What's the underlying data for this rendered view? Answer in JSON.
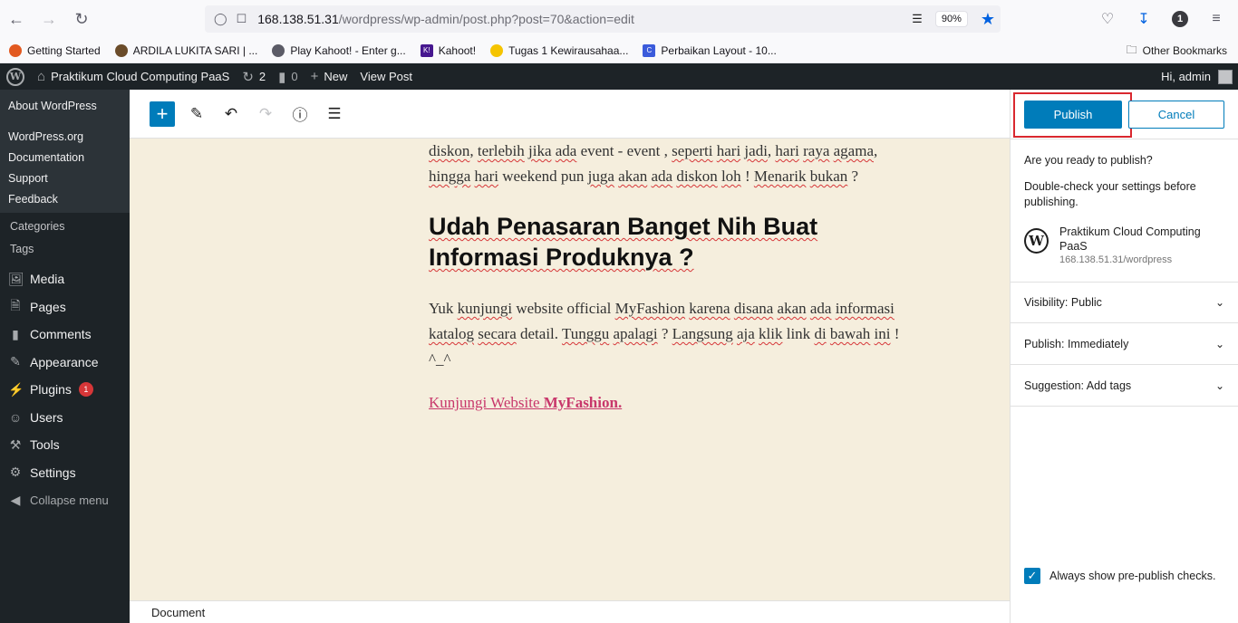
{
  "browser": {
    "url_host": "168.138.51.31",
    "url_path": "/wordpress/wp-admin/post.php?post=70&action=edit",
    "zoom": "90%",
    "account_badge": "1"
  },
  "bookmarks": [
    {
      "label": "Getting Started",
      "color": "#e25920"
    },
    {
      "label": "ARDILA LUKITA SARI | ...",
      "color": "#6b4c2a"
    },
    {
      "label": "Play Kahoot! - Enter g...",
      "color": "#5b5b66"
    },
    {
      "label": "Kahoot!",
      "color": "#46178f",
      "glyph": "K!"
    },
    {
      "label": "Tugas 1 Kewirausahaa...",
      "color": "#f5c400"
    },
    {
      "label": "Perbaikan Layout - 10...",
      "color": "#3b5bdb",
      "glyph": "C"
    }
  ],
  "bookmarks_other": "Other Bookmarks",
  "adminbar": {
    "site_name": "Praktikum Cloud Computing PaaS",
    "updates_count": "2",
    "comments_count": "0",
    "new_label": "New",
    "view_post_label": "View Post",
    "greeting": "Hi, admin"
  },
  "sidebar": {
    "about": "About WordPress",
    "wp_links": [
      "WordPress.org",
      "Documentation",
      "Support",
      "Feedback"
    ],
    "post_sub": [
      "Categories",
      "Tags"
    ],
    "menu": [
      {
        "label": "Media",
        "icon": "media-icon"
      },
      {
        "label": "Pages",
        "icon": "pages-icon"
      },
      {
        "label": "Comments",
        "icon": "comments-icon"
      },
      {
        "label": "Appearance",
        "icon": "appearance-icon"
      },
      {
        "label": "Plugins",
        "icon": "plugins-icon",
        "badge": "1"
      },
      {
        "label": "Users",
        "icon": "users-icon"
      },
      {
        "label": "Tools",
        "icon": "tools-icon"
      },
      {
        "label": "Settings",
        "icon": "settings-icon"
      }
    ],
    "collapse": "Collapse menu"
  },
  "content": {
    "para1_line1": [
      "diskon",
      ", ",
      "terlebih",
      " ",
      "jika",
      " ",
      "ada",
      " event - event , ",
      "seperti",
      " ",
      "hari",
      " ",
      "jadi",
      ", ",
      "hari",
      " ",
      "raya",
      " ",
      "agama",
      ","
    ],
    "para1_line2": [
      "hingga",
      " ",
      "hari",
      " weekend pun ",
      "juga",
      " ",
      "akan",
      " ",
      "ada",
      " ",
      "diskon",
      " ",
      "loh",
      " ! ",
      "Menarik",
      " ",
      "bukan",
      " ?"
    ],
    "heading_line1": "Udah Penasaran Banget Nih Buat",
    "heading_line2": "Informasi Produknya ?",
    "para2_line1": [
      "Yuk ",
      "kunjungi",
      " website official ",
      "MyFashion",
      " ",
      "karena",
      " ",
      "disana",
      " ",
      "akan",
      " ",
      "ada",
      " ",
      "informasi"
    ],
    "para2_line2": [
      "katalog",
      " ",
      "secara",
      " detail. ",
      "Tunggu",
      " ",
      "apalagi",
      " ? ",
      "Langsung",
      " ",
      "aja",
      " ",
      "klik",
      " link ",
      "di",
      " ",
      "bawah",
      " ",
      "ini",
      " !"
    ],
    "para2_line3": "^_^",
    "link_text": "Kunjungi Website ",
    "link_bold": "MyFashion."
  },
  "footer": {
    "label": "Document"
  },
  "panel": {
    "publish": "Publish",
    "cancel": "Cancel",
    "ready_q": "Are you ready to publish?",
    "ready_d": "Double-check your settings before publishing.",
    "site_name": "Praktikum Cloud Computing PaaS",
    "site_url": "168.138.51.31/wordpress",
    "sections": [
      {
        "label": "Visibility: Public"
      },
      {
        "label": "Publish: Immediately"
      },
      {
        "label": "Suggestion: Add tags"
      }
    ],
    "always_show": "Always show pre-publish checks."
  }
}
